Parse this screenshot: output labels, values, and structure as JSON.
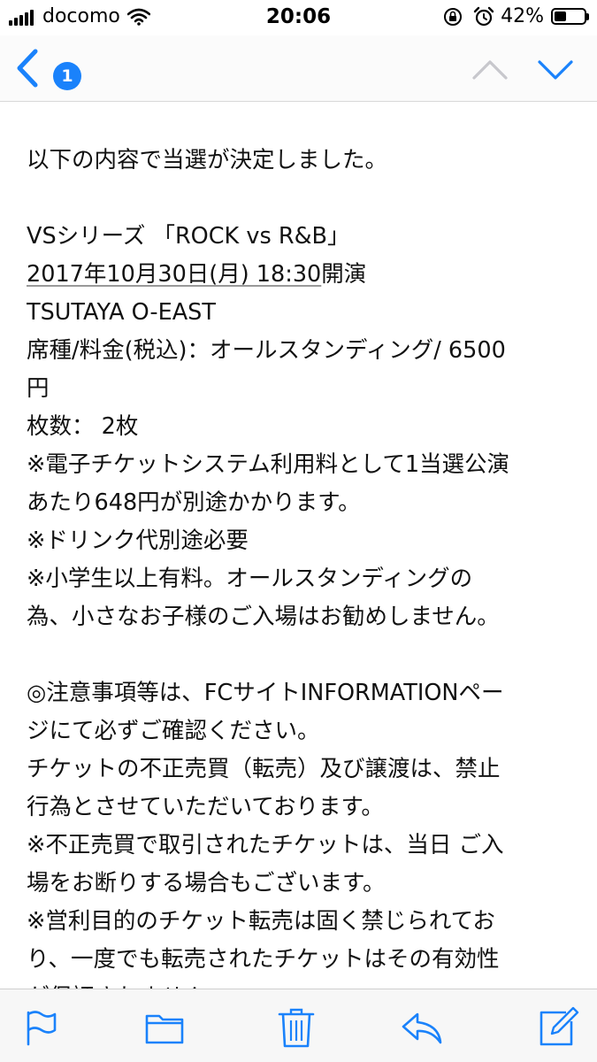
{
  "status_bar": {
    "carrier": "docomo",
    "time": "20:06",
    "battery": "42%",
    "battery_level": 0.42
  },
  "nav": {
    "badge": "1",
    "back_icon": "chevron-left-icon",
    "up_icon": "chevron-up-icon",
    "down_icon": "chevron-down-icon"
  },
  "mail": {
    "intro": "以下の内容で当選が決定しました。",
    "event_title": "VSシリーズ 「ROCK vs R&B」",
    "date": "2017年10月30日(月) 18:30",
    "date_suffix": "開演",
    "venue": "TSUTAYA O-EAST",
    "seat_line1": "席種/料金(税込)：オールスタンディング/ 6500",
    "seat_line2": "円",
    "count": "枚数： 2枚",
    "note1_line1": "※電子チケットシステム利用料として1当選公演",
    "note1_line2": "あたり648円が別途かかります。",
    "note2": "※ドリンク代別途必要",
    "note3_line1": "※小学生以上有料。オールスタンディングの",
    "note3_line2": "為、小さなお子様のご入場はお勧めしません。",
    "caution_line1": "◎注意事項等は、FCサイトINFORMATIONペー",
    "caution_line2": "ジにて必ずご確認ください。",
    "resale_line1": "チケットの不正売買（転売）及び譲渡は、禁止",
    "resale_line2": "行為とさせていただいております。",
    "fraud_line1": "※不正売買で取引されたチケットは、当日 ご入",
    "fraud_line2": "場をお断りする場合もございます。",
    "profit_line1": "※営利目的のチケット転売は固く禁じられてお",
    "profit_line2": "り、一度でも転売されたチケットはその有効性",
    "profit_line3": "が保証されません。"
  },
  "toolbar": {
    "icons": [
      "flag-icon",
      "folder-icon",
      "trash-icon",
      "reply-icon",
      "compose-icon"
    ]
  },
  "colors": {
    "accent": "#1a82fb",
    "disabled": "#c7c7cc"
  }
}
